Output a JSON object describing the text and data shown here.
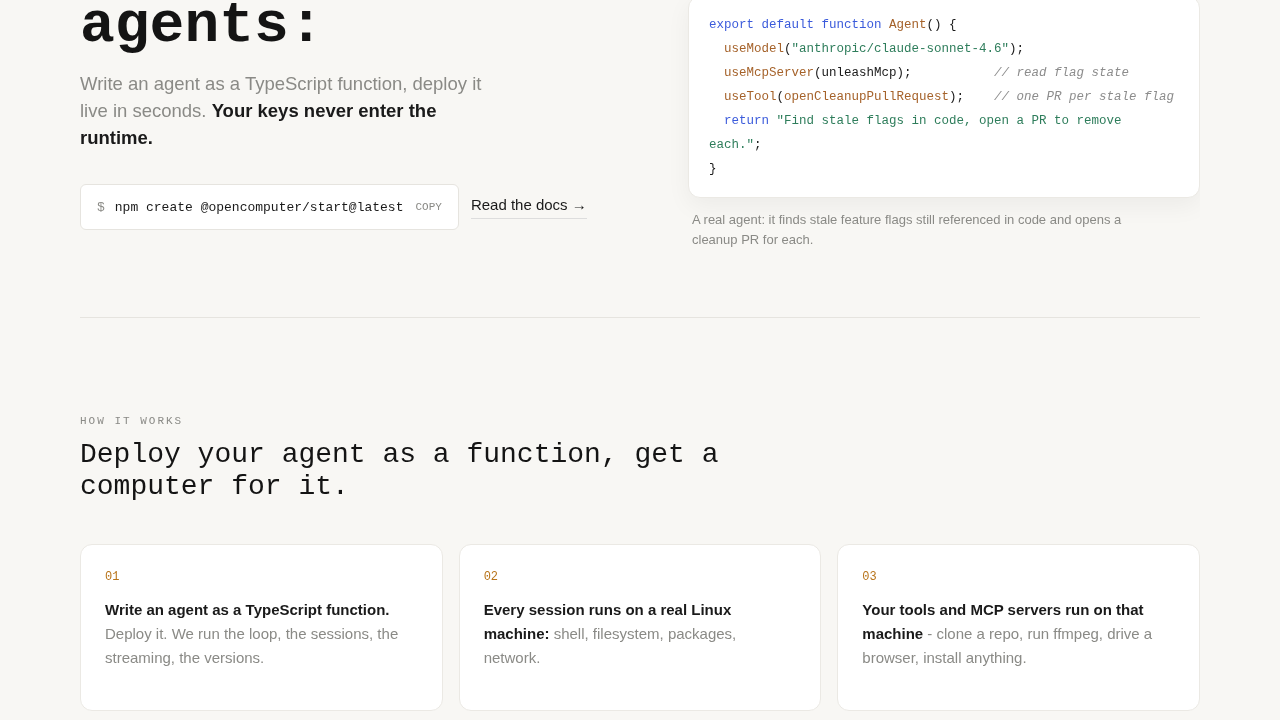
{
  "hero": {
    "heading": "agents:",
    "lede": "Write an agent as a TypeScript function, deploy it live in seconds. **Your keys never enter the runtime.**",
    "command": {
      "prompt": "$",
      "text": "npm create @opencomputer/start@latest",
      "copy_label": "COPY"
    },
    "docs_link": "Read the docs →"
  },
  "code": {
    "lines": [
      {
        "indent": false,
        "tokens": [
          {
            "kind": "keyword",
            "text": "export default function "
          },
          {
            "kind": "fn",
            "text": "Agent"
          },
          {
            "kind": "plain",
            "text": "() {"
          }
        ]
      },
      {
        "indent": true,
        "tokens": [
          {
            "kind": "fn",
            "text": "useModel"
          },
          {
            "kind": "plain",
            "text": "("
          },
          {
            "kind": "string",
            "text": "\"anthropic/claude-sonnet-4.6\""
          },
          {
            "kind": "plain",
            "text": ");"
          }
        ]
      },
      {
        "indent": true,
        "tokens": [
          {
            "kind": "fn",
            "text": "useMcpServer"
          },
          {
            "kind": "plain",
            "text": "(unleashMcp);"
          }
        ],
        "comment": "// read flag state"
      },
      {
        "indent": true,
        "tokens": [
          {
            "kind": "fn",
            "text": "useTool"
          },
          {
            "kind": "plain",
            "text": "("
          },
          {
            "kind": "fn",
            "text": "openCleanupPullRequest"
          },
          {
            "kind": "plain",
            "text": ");"
          }
        ],
        "comment": "// one PR per stale flag"
      },
      {
        "indent": true,
        "tokens": [
          {
            "kind": "keyword",
            "text": "return "
          },
          {
            "kind": "string",
            "text": "\"Find stale flags in code, open a PR to remove each.\""
          },
          {
            "kind": "plain",
            "text": ";"
          }
        ]
      },
      {
        "indent": false,
        "tokens": [
          {
            "kind": "plain",
            "text": "}"
          }
        ]
      }
    ],
    "caption": "A real agent: it finds stale feature flags still referenced in code and opens a cleanup PR for each."
  },
  "how_it_works": {
    "eyebrow": "HOW IT WORKS",
    "heading": "Deploy your agent as a function, get a computer for it.",
    "steps": [
      {
        "number": "01",
        "text": "**Write an agent as a TypeScript function.** Deploy it. We run the loop, the sessions, the streaming, the versions."
      },
      {
        "number": "02",
        "text": "**Every session runs on a real Linux machine:** shell, filesystem, packages, network."
      },
      {
        "number": "03",
        "text": "**Your tools and MCP servers run on that machine** - clone a repo, run ffmpeg, drive a browser, install anything."
      }
    ]
  }
}
